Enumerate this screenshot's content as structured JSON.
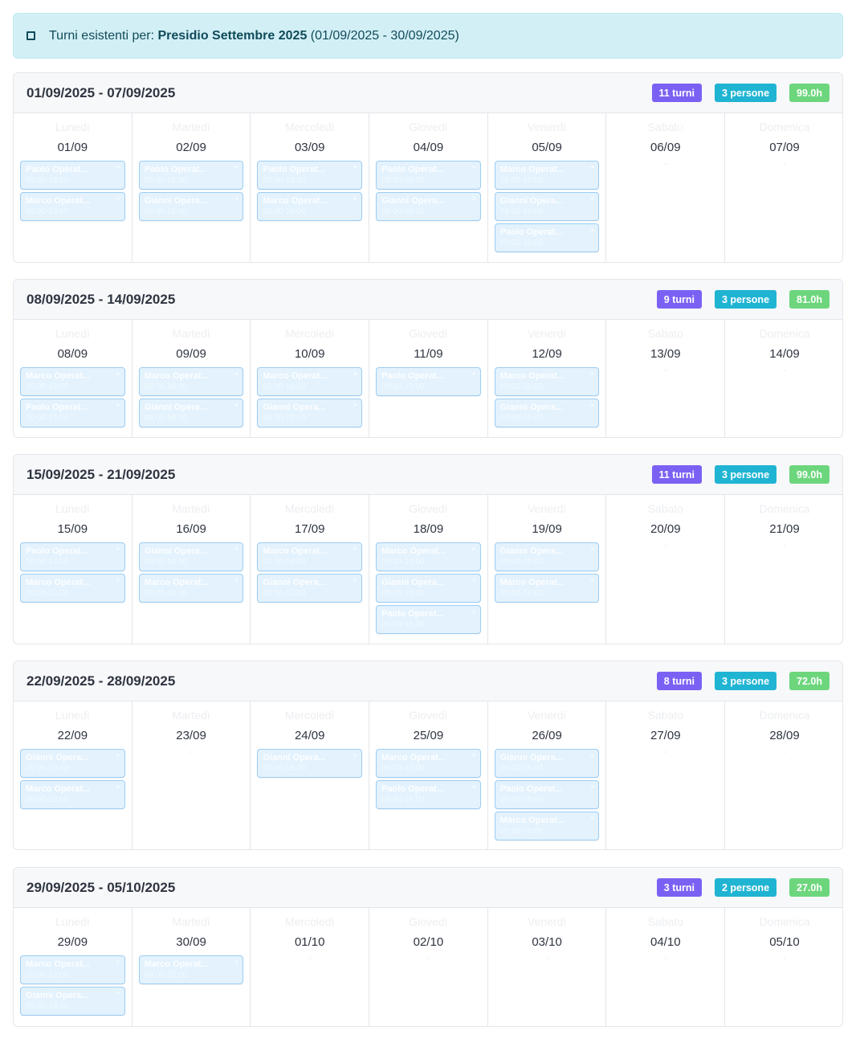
{
  "banner": {
    "prefix": "Turni esistenti per:",
    "name": "Presidio Settembre 2025",
    "range": "(01/09/2025 - 30/09/2025)",
    "icon": "square-icon"
  },
  "weeks": [
    {
      "title": "01/09/2025 - 07/09/2025",
      "turni": "11 turni",
      "persone": "3 persone",
      "ore": "99.0h",
      "days": [
        {
          "name": "Lunedì",
          "date": "01/09",
          "shifts": [
            {
              "who": "Paolo Operat...",
              "hrs": "09:00-18:00"
            },
            {
              "who": "Marco Operat...",
              "hrs": "09:00-18:00"
            }
          ]
        },
        {
          "name": "Martedì",
          "date": "02/09",
          "shifts": [
            {
              "who": "Paolo Operat...",
              "hrs": "09:00-18:00"
            },
            {
              "who": "Gianni Opera...",
              "hrs": "09:00-18:00"
            }
          ]
        },
        {
          "name": "Mercoledì",
          "date": "03/09",
          "shifts": [
            {
              "who": "Paolo Operat...",
              "hrs": "09:00-18:00"
            },
            {
              "who": "Marco Operat...",
              "hrs": "09:00-18:00"
            }
          ]
        },
        {
          "name": "Giovedì",
          "date": "04/09",
          "shifts": [
            {
              "who": "Paolo Operat...",
              "hrs": "09:00-18:00"
            },
            {
              "who": "Gianni Opera...",
              "hrs": "09:00-18:00"
            }
          ]
        },
        {
          "name": "Venerdì",
          "date": "05/09",
          "shifts": [
            {
              "who": "Marco Operat...",
              "hrs": "09:00-18:00"
            },
            {
              "who": "Gianni Opera...",
              "hrs": "09:00-18:00"
            },
            {
              "who": "Paolo Operat...",
              "hrs": "09:00-18:00"
            }
          ]
        },
        {
          "name": "Sabato",
          "date": "06/09",
          "shifts": [],
          "empty": "-"
        },
        {
          "name": "Domenica",
          "date": "07/09",
          "shifts": [],
          "empty": "-"
        }
      ]
    },
    {
      "title": "08/09/2025 - 14/09/2025",
      "turni": "9 turni",
      "persone": "3 persone",
      "ore": "81.0h",
      "days": [
        {
          "name": "Lunedì",
          "date": "08/09",
          "shifts": [
            {
              "who": "Marco Operat...",
              "hrs": "09:00-18:00"
            },
            {
              "who": "Paolo Operat...",
              "hrs": "09:00-18:00"
            }
          ]
        },
        {
          "name": "Martedì",
          "date": "09/09",
          "shifts": [
            {
              "who": "Marco Operat...",
              "hrs": "09:00-18:00"
            },
            {
              "who": "Gianni Opera...",
              "hrs": "09:00-18:00"
            }
          ]
        },
        {
          "name": "Mercoledì",
          "date": "10/09",
          "shifts": [
            {
              "who": "Marco Operat...",
              "hrs": "09:00-18:00"
            },
            {
              "who": "Gianni Opera...",
              "hrs": "09:00-18:00"
            }
          ]
        },
        {
          "name": "Giovedì",
          "date": "11/09",
          "shifts": [
            {
              "who": "Paolo Operat...",
              "hrs": "09:00-18:00"
            }
          ]
        },
        {
          "name": "Venerdì",
          "date": "12/09",
          "shifts": [
            {
              "who": "Marco Operat...",
              "hrs": "09:00-18:00"
            },
            {
              "who": "Gianni Opera...",
              "hrs": "09:00-18:00"
            }
          ]
        },
        {
          "name": "Sabato",
          "date": "13/09",
          "shifts": [],
          "empty": "-"
        },
        {
          "name": "Domenica",
          "date": "14/09",
          "shifts": [],
          "empty": "-"
        }
      ]
    },
    {
      "title": "15/09/2025 - 21/09/2025",
      "turni": "11 turni",
      "persone": "3 persone",
      "ore": "99.0h",
      "days": [
        {
          "name": "Lunedì",
          "date": "15/09",
          "shifts": [
            {
              "who": "Paolo Operat...",
              "hrs": "09:00-18:00"
            },
            {
              "who": "Marco Operat...",
              "hrs": "09:00-18:00"
            }
          ]
        },
        {
          "name": "Martedì",
          "date": "16/09",
          "shifts": [
            {
              "who": "Gianni Opera...",
              "hrs": "09:00-18:00"
            },
            {
              "who": "Marco Operat...",
              "hrs": "09:00-18:00"
            }
          ]
        },
        {
          "name": "Mercoledì",
          "date": "17/09",
          "shifts": [
            {
              "who": "Marco Operat...",
              "hrs": "09:00-18:00"
            },
            {
              "who": "Gianni Opera...",
              "hrs": "09:00-18:00"
            }
          ]
        },
        {
          "name": "Giovedì",
          "date": "18/09",
          "shifts": [
            {
              "who": "Marco Operat...",
              "hrs": "09:00-18:00"
            },
            {
              "who": "Gianni Opera...",
              "hrs": "09:00-18:00"
            },
            {
              "who": "Paolo Operat...",
              "hrs": "09:00-18:00"
            }
          ]
        },
        {
          "name": "Venerdì",
          "date": "19/09",
          "shifts": [
            {
              "who": "Gianni Opera...",
              "hrs": "09:00-18:00"
            },
            {
              "who": "Marco Operat...",
              "hrs": "09:00-18:00"
            }
          ]
        },
        {
          "name": "Sabato",
          "date": "20/09",
          "shifts": [],
          "empty": "-"
        },
        {
          "name": "Domenica",
          "date": "21/09",
          "shifts": [],
          "empty": "-"
        }
      ]
    },
    {
      "title": "22/09/2025 - 28/09/2025",
      "turni": "8 turni",
      "persone": "3 persone",
      "ore": "72.0h",
      "days": [
        {
          "name": "Lunedì",
          "date": "22/09",
          "shifts": [
            {
              "who": "Gianni Opera...",
              "hrs": "09:00-18:00"
            },
            {
              "who": "Marco Operat...",
              "hrs": "09:00-18:00"
            }
          ]
        },
        {
          "name": "Martedì",
          "date": "23/09",
          "shifts": [],
          "empty": "-"
        },
        {
          "name": "Mercoledì",
          "date": "24/09",
          "shifts": [
            {
              "who": "Gianni Opera...",
              "hrs": "09:00-18:00"
            }
          ]
        },
        {
          "name": "Giovedì",
          "date": "25/09",
          "shifts": [
            {
              "who": "Marco Operat...",
              "hrs": "09:00-18:00"
            },
            {
              "who": "Paolo Operat...",
              "hrs": "09:00-18:00"
            }
          ]
        },
        {
          "name": "Venerdì",
          "date": "26/09",
          "shifts": [
            {
              "who": "Gianni Opera...",
              "hrs": "09:00-18:00"
            },
            {
              "who": "Paolo Operat...",
              "hrs": "09:00-18:00"
            },
            {
              "who": "Marco Operat...",
              "hrs": "09:00-18:00"
            }
          ]
        },
        {
          "name": "Sabato",
          "date": "27/09",
          "shifts": [],
          "empty": "-"
        },
        {
          "name": "Domenica",
          "date": "28/09",
          "shifts": [],
          "empty": "-"
        }
      ]
    },
    {
      "title": "29/09/2025 - 05/10/2025",
      "turni": "3 turni",
      "persone": "2 persone",
      "ore": "27.0h",
      "days": [
        {
          "name": "Lunedì",
          "date": "29/09",
          "shifts": [
            {
              "who": "Marco Operat...",
              "hrs": "09:00-18:00"
            },
            {
              "who": "Gianni Opera...",
              "hrs": "09:00-18:00"
            }
          ]
        },
        {
          "name": "Martedì",
          "date": "30/09",
          "shifts": [
            {
              "who": "Marco Operat...",
              "hrs": "09:00-18:00"
            }
          ]
        },
        {
          "name": "Mercoledì",
          "date": "01/10",
          "shifts": [],
          "empty": "-"
        },
        {
          "name": "Giovedì",
          "date": "02/10",
          "shifts": [],
          "empty": "-"
        },
        {
          "name": "Venerdì",
          "date": "03/10",
          "shifts": [],
          "empty": "-"
        },
        {
          "name": "Sabato",
          "date": "04/10",
          "shifts": [],
          "empty": "-"
        },
        {
          "name": "Domenica",
          "date": "05/10",
          "shifts": [],
          "empty": "-"
        }
      ]
    }
  ],
  "colors": {
    "turni_badge": "#7b61f3",
    "persone_badge": "#20b4d3",
    "ore_badge": "#6dd67d",
    "shift_bg": "#e3f2fd",
    "shift_border": "#9ccdf4",
    "banner_bg": "#d3eff6"
  }
}
